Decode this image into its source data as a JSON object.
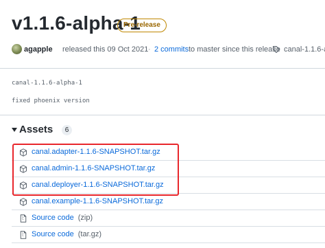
{
  "release": {
    "title": "v1.1.6-alpha-1",
    "badge": "Pre-release",
    "author": "agapple",
    "released_text": "released this 09 Oct 2021",
    "commits_link": "2 commits",
    "commits_text": "to master since this release",
    "dot": "·",
    "tag": "canal-1.1.6-al"
  },
  "body": {
    "line1": "canal-1.1.6-alpha-1",
    "line2": "fixed phoenix version"
  },
  "assets": {
    "title": "Assets",
    "count": "6",
    "items": [
      {
        "name": "canal.adapter-1.1.6-SNAPSHOT.tar.gz",
        "suffix": "",
        "icon": "package-icon"
      },
      {
        "name": "canal.admin-1.1.6-SNAPSHOT.tar.gz",
        "suffix": "",
        "icon": "package-icon"
      },
      {
        "name": "canal.deployer-1.1.6-SNAPSHOT.tar.gz",
        "suffix": "",
        "icon": "package-icon"
      },
      {
        "name": "canal.example-1.1.6-SNAPSHOT.tar.gz",
        "suffix": "",
        "icon": "package-icon"
      },
      {
        "name": "Source code",
        "suffix": "(zip)",
        "icon": "file-zip-icon"
      },
      {
        "name": "Source code",
        "suffix": "(tar.gz)",
        "icon": "file-zip-icon"
      }
    ]
  },
  "colors": {
    "link": "#0969da",
    "badge_border": "#bf8700",
    "highlight": "#e8262b"
  }
}
